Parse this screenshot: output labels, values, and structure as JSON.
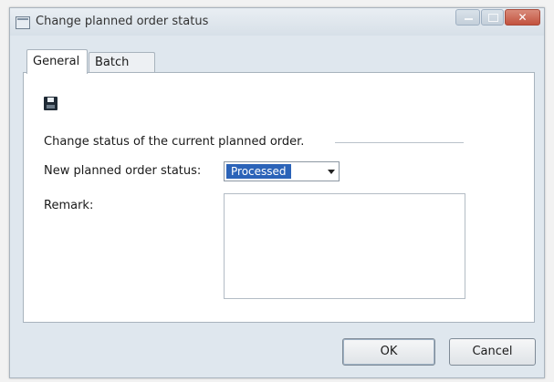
{
  "window": {
    "title": "Change planned order status"
  },
  "tabs": [
    {
      "label": "General",
      "active": true
    },
    {
      "label": "Batch",
      "active": false
    }
  ],
  "general": {
    "section_text": "Change status of the current planned order.",
    "status_label": "New planned order status:",
    "status_value": "Processed",
    "remark_label": "Remark:",
    "remark_value": ""
  },
  "buttons": {
    "ok": "OK",
    "cancel": "Cancel"
  },
  "icons": {
    "app": "window-icon",
    "save": "save-icon"
  },
  "colors": {
    "selection": "#2b63b8",
    "close_button": "#c2523e"
  }
}
